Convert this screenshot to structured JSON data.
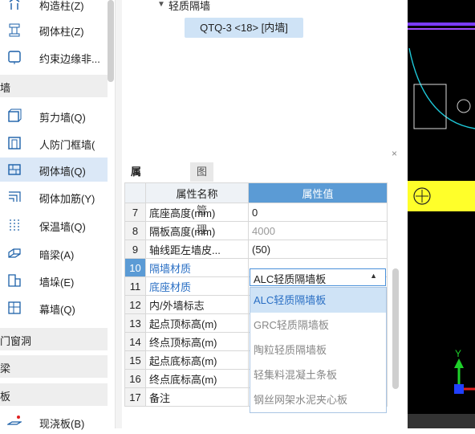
{
  "sidebar": {
    "items": [
      {
        "label": "构造柱(Z)",
        "icon": "structural-column-icon"
      },
      {
        "label": "砌体柱(Z)",
        "icon": "masonry-column-icon"
      },
      {
        "label": "约束边缘非...",
        "icon": "edge-constraint-icon"
      },
      {
        "label": "剪力墙(Q)",
        "icon": "shear-wall-icon"
      },
      {
        "label": "人防门框墙(",
        "icon": "civil-defense-door-wall-icon"
      },
      {
        "label": "砌体墙(Q)",
        "icon": "masonry-wall-icon"
      },
      {
        "label": "砌体加筋(Y)",
        "icon": "masonry-rebar-icon"
      },
      {
        "label": "保温墙(Q)",
        "icon": "insulation-wall-icon"
      },
      {
        "label": "暗梁(A)",
        "icon": "hidden-beam-icon"
      },
      {
        "label": "墙垛(E)",
        "icon": "wall-pier-icon"
      },
      {
        "label": "幕墙(Q)",
        "icon": "curtain-wall-icon"
      },
      {
        "label": "现浇板(B)",
        "icon": "cast-slab-icon"
      }
    ],
    "groups": [
      "墙",
      "门窗洞",
      "梁",
      "板"
    ]
  },
  "tree": {
    "parent": "轻质隔墙",
    "node": "QTQ-3 <18> [内墙]"
  },
  "panel": {
    "tabs": [
      "属性列表",
      "图层管理"
    ],
    "headers": {
      "name": "属性名称",
      "value": "属性值"
    },
    "rows": [
      {
        "idx": "7",
        "name": "底座高度(mm)",
        "value": "0"
      },
      {
        "idx": "8",
        "name": "隔板高度(mm)",
        "value": "4000"
      },
      {
        "idx": "9",
        "name": "轴线距左墙皮...",
        "value": "(50)"
      },
      {
        "idx": "10",
        "name": "隔墙材质",
        "value": ""
      },
      {
        "idx": "11",
        "name": "底座材质",
        "value": ""
      },
      {
        "idx": "12",
        "name": "内/外墙标志",
        "value": ""
      },
      {
        "idx": "13",
        "name": "起点顶标高(m)",
        "value": ""
      },
      {
        "idx": "14",
        "name": "终点顶标高(m)",
        "value": ""
      },
      {
        "idx": "15",
        "name": "起点底标高(m)",
        "value": ""
      },
      {
        "idx": "16",
        "name": "终点底标高(m)",
        "value": ""
      },
      {
        "idx": "17",
        "name": "备注",
        "value": ""
      }
    ],
    "close": "×"
  },
  "dropdown": {
    "selected": "ALC轻质隔墙板",
    "options": [
      "ALC轻质隔墙板",
      "GRC轻质隔墙板",
      "陶粒轻质隔墙板",
      "轻集料混凝土条板",
      "钢丝网架水泥夹心板"
    ]
  },
  "colors": {
    "accent": "#5b9bd5",
    "highlight": "#cfe3f6",
    "link": "#2a6fc4"
  }
}
